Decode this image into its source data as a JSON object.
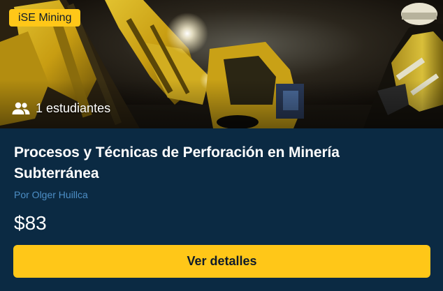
{
  "badge": {
    "label": "iSE Mining"
  },
  "students": {
    "label": "1 estudiantes",
    "icon": "people-icon"
  },
  "course": {
    "title": "Procesos y Técnicas de Perforación en Minería Subterránea",
    "author": "Por Olger Huillca",
    "price": "$83"
  },
  "cta": {
    "label": "Ver detalles"
  },
  "colors": {
    "accent": "#ffc718",
    "background": "#0b2a43",
    "author_link": "#4d8fc6",
    "text": "#ffffff"
  }
}
